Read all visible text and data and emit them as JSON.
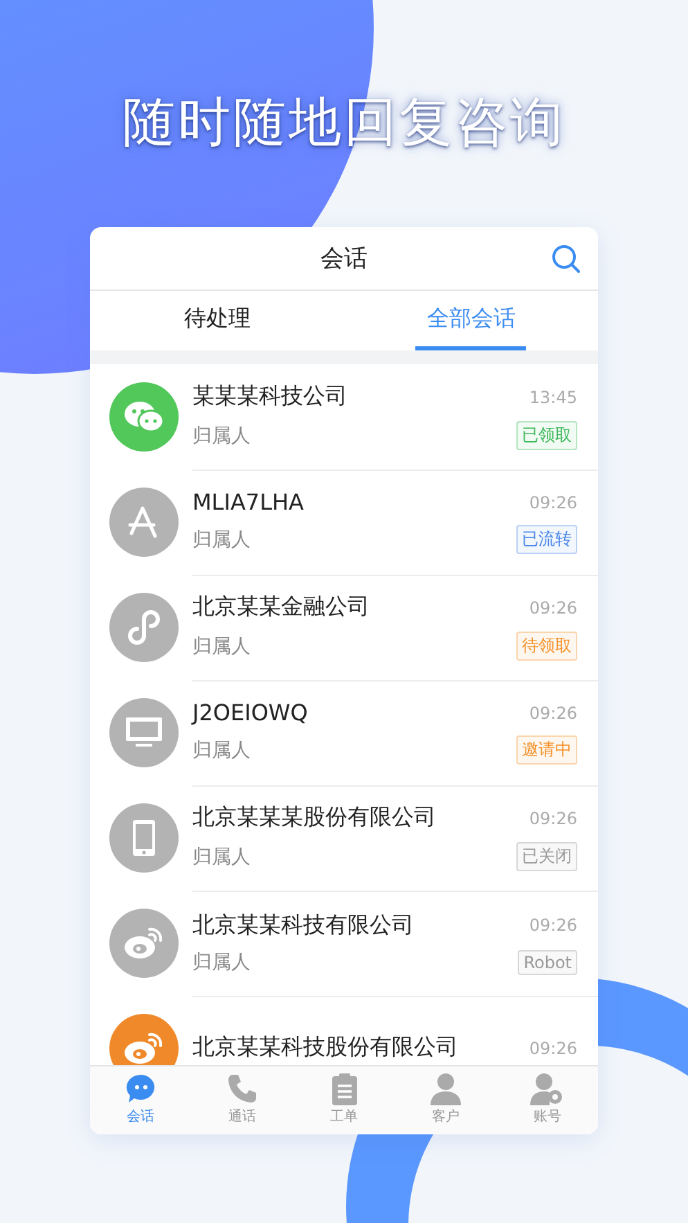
{
  "headline": "随时随地回复咨询",
  "header": {
    "title": "会话"
  },
  "tabs": [
    {
      "label": "待处理",
      "selected": false
    },
    {
      "label": "全部会话",
      "selected": true
    }
  ],
  "conversations": [
    {
      "name": "某某某科技公司",
      "time": "13:45",
      "subtitle": "归属人",
      "tag": {
        "label": "已领取",
        "color": "#3cb95a"
      },
      "avatar": {
        "kind": "chat",
        "color": "#52c75a"
      }
    },
    {
      "name": "MLIA7LHA",
      "time": "09:26",
      "subtitle": "归属人",
      "tag": {
        "label": "已流转",
        "color": "#4a86e8"
      },
      "avatar": {
        "kind": "appstore",
        "color": "#b3b3b3"
      }
    },
    {
      "name": "北京某某金融公司",
      "time": "09:26",
      "subtitle": "归属人",
      "tag": {
        "label": "待领取",
        "color": "#f5922a"
      },
      "avatar": {
        "kind": "link",
        "color": "#b3b3b3"
      }
    },
    {
      "name": "J2OEIOWQ",
      "time": "09:26",
      "subtitle": "归属人",
      "tag": {
        "label": "邀请中",
        "color": "#f5922a"
      },
      "avatar": {
        "kind": "monitor",
        "color": "#b3b3b3"
      }
    },
    {
      "name": "北京某某某股份有限公司",
      "time": "09:26",
      "subtitle": "归属人",
      "tag": {
        "label": "已关闭",
        "color": "#999999"
      },
      "avatar": {
        "kind": "phone",
        "color": "#b3b3b3"
      }
    },
    {
      "name": "北京某某科技有限公司",
      "time": "09:26",
      "subtitle": "归属人",
      "tag": {
        "label": "Robot",
        "color": "#999999"
      },
      "avatar": {
        "kind": "weibo",
        "color": "#b3b3b3"
      }
    },
    {
      "name": "北京某某科技股份有限公司",
      "time": "09:26",
      "avatar": {
        "kind": "weibo",
        "color": "#f0892a"
      }
    }
  ],
  "nav": [
    {
      "label": "会话",
      "kind": "chat",
      "selected": true
    },
    {
      "label": "通话",
      "kind": "phone",
      "selected": false
    },
    {
      "label": "工单",
      "kind": "clipboard",
      "selected": false
    },
    {
      "label": "客户",
      "kind": "person",
      "selected": false
    },
    {
      "label": "账号",
      "kind": "account",
      "selected": false
    }
  ]
}
